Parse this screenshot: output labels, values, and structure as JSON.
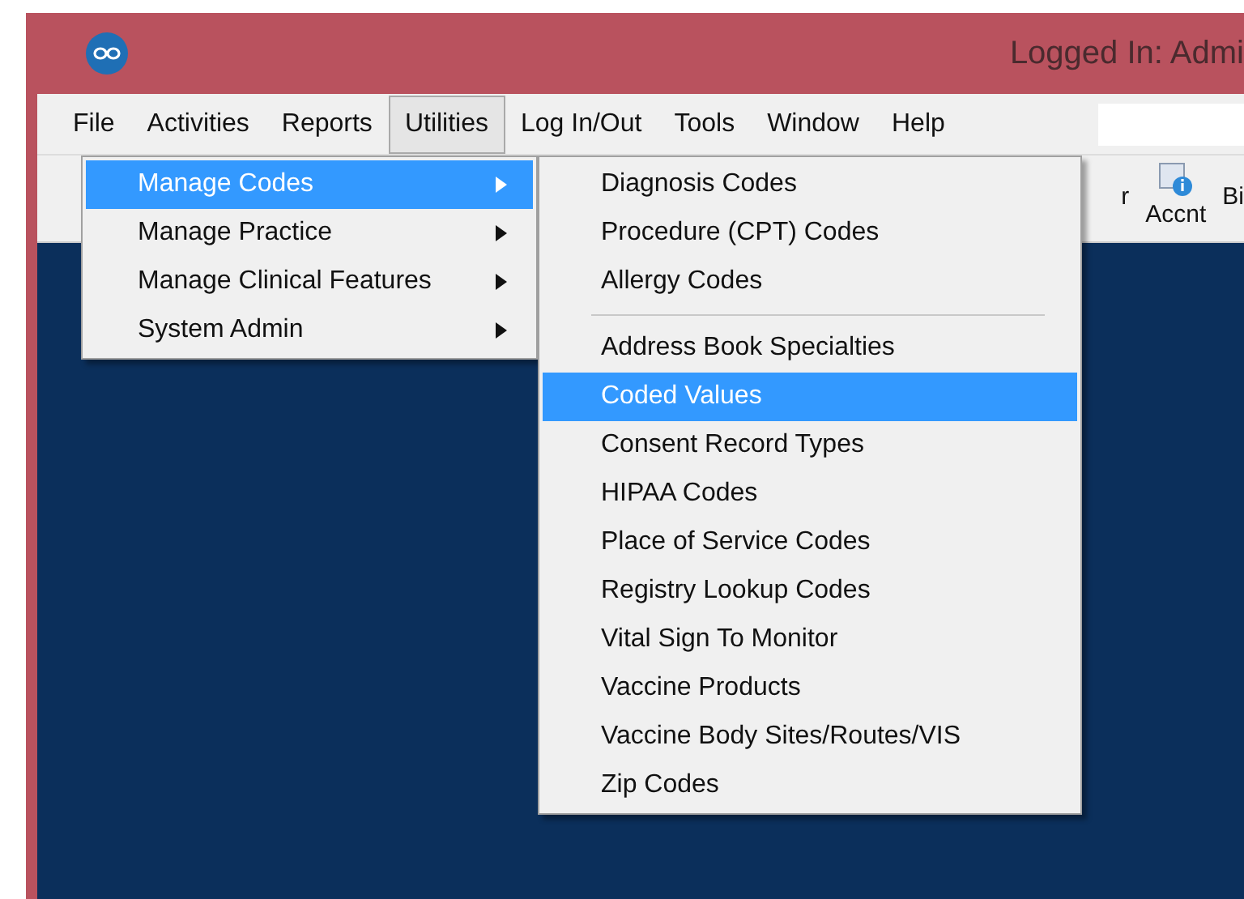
{
  "window": {
    "title": "Logged In: Admi"
  },
  "menu_bar": [
    {
      "label": "File",
      "selected": false
    },
    {
      "label": "Activities",
      "selected": false
    },
    {
      "label": "Reports",
      "selected": false
    },
    {
      "label": "Utilities",
      "selected": true
    },
    {
      "label": "Log In/Out",
      "selected": false
    },
    {
      "label": "Tools",
      "selected": false
    },
    {
      "label": "Window",
      "selected": false
    },
    {
      "label": "Help",
      "selected": false
    }
  ],
  "toolbar": [
    {
      "kind": "text",
      "label": "r"
    },
    {
      "kind": "icon",
      "label": "Accnt"
    },
    {
      "kind": "text",
      "label": "Bi"
    }
  ],
  "utilities_menu": [
    {
      "label": "Manage Codes",
      "selected": true,
      "submenu": true
    },
    {
      "label": "Manage Practice",
      "selected": false,
      "submenu": true
    },
    {
      "label": "Manage Clinical Features",
      "selected": false,
      "submenu": true
    },
    {
      "label": "System Admin",
      "selected": false,
      "submenu": true
    }
  ],
  "manage_codes_menu": [
    {
      "kind": "item",
      "label": "Diagnosis Codes",
      "selected": false
    },
    {
      "kind": "item",
      "label": "Procedure (CPT) Codes",
      "selected": false
    },
    {
      "kind": "item",
      "label": "Allergy Codes",
      "selected": false
    },
    {
      "kind": "separator"
    },
    {
      "kind": "item",
      "label": "Address Book Specialties",
      "selected": false
    },
    {
      "kind": "item",
      "label": "Coded Values",
      "selected": true
    },
    {
      "kind": "item",
      "label": "Consent Record Types",
      "selected": false
    },
    {
      "kind": "item",
      "label": "HIPAA Codes",
      "selected": false
    },
    {
      "kind": "item",
      "label": "Place of Service Codes",
      "selected": false
    },
    {
      "kind": "item",
      "label": "Registry Lookup Codes",
      "selected": false
    },
    {
      "kind": "item",
      "label": "Vital Sign To Monitor",
      "selected": false
    },
    {
      "kind": "item",
      "label": "Vaccine Products",
      "selected": false
    },
    {
      "kind": "item",
      "label": "Vaccine Body Sites/Routes/VIS",
      "selected": false
    },
    {
      "kind": "item",
      "label": "Zip Codes",
      "selected": false
    }
  ]
}
